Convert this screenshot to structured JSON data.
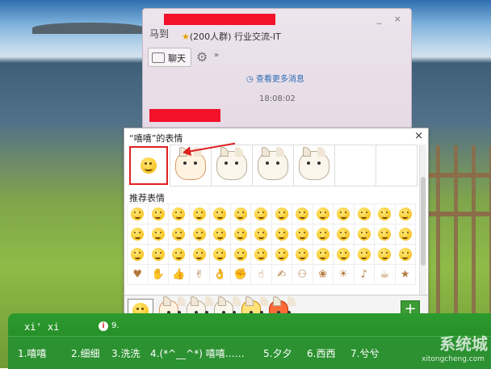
{
  "chat": {
    "title": "(200人群) 行业交流-IT",
    "avatar_text": "马到",
    "window_buttons": "_ ×",
    "tab_label": "聊天",
    "more": "»",
    "view_more": "查看更多消息",
    "timestamp": "18:08:02"
  },
  "emoji_panel": {
    "title": "“嘻嘻”的表情",
    "close": "×",
    "recommended_title": "推荐表情",
    "add_button": "+"
  },
  "ime": {
    "pinyin": "xi' xi",
    "info": "9.",
    "candidates": [
      "1.嘻嘻",
      "2.细细",
      "3.洗洗",
      "4.(*^__^*) 嘻嘻……",
      "5.夕夕",
      "6.西西",
      "7.兮兮"
    ]
  },
  "watermark": {
    "text": "系统城",
    "url": "xitongcheng.com"
  },
  "colors": {
    "accent_red": "#e02020",
    "ime_green": "#2c9b2e",
    "link_blue": "#2c6bb4"
  }
}
